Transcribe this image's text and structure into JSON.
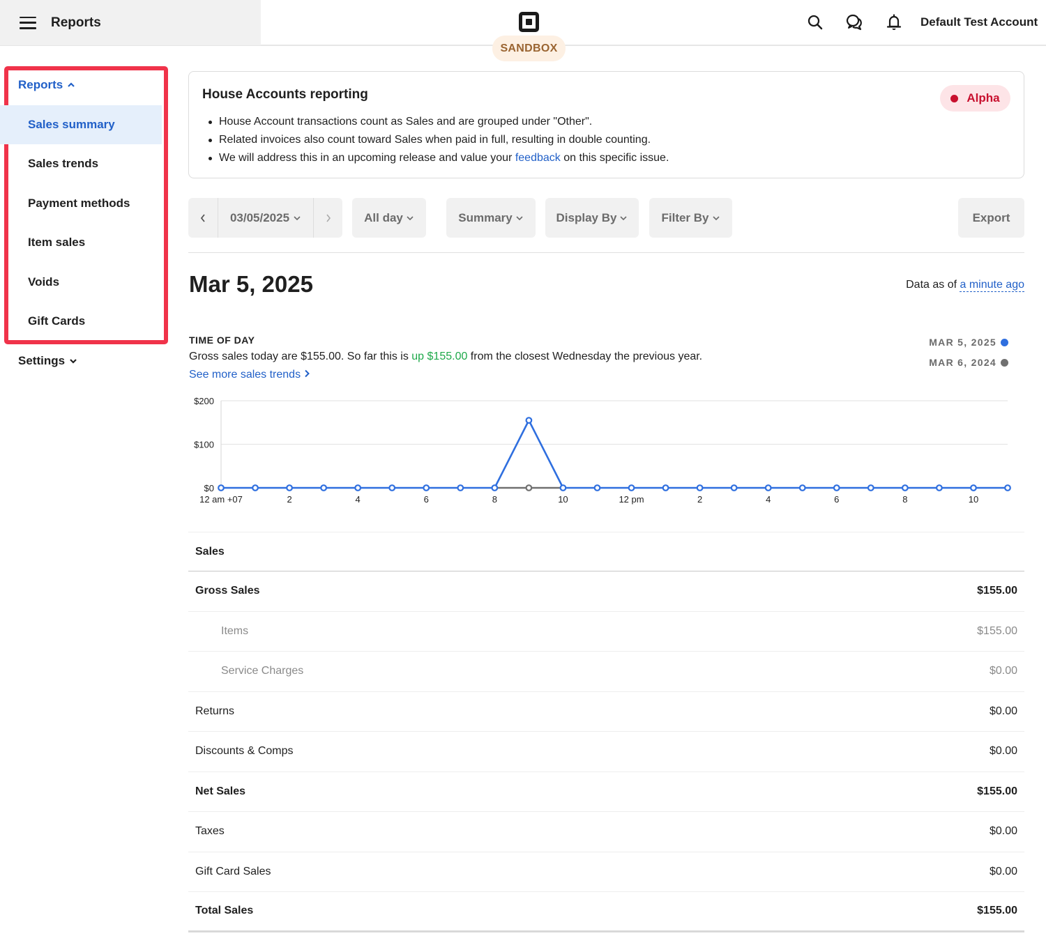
{
  "topbar": {
    "title": "Reports",
    "sandbox_label": "SANDBOX",
    "account_name": "Default Test Account",
    "icons": [
      "menu-icon",
      "square-logo-icon",
      "search-icon",
      "messages-icon",
      "bell-icon"
    ]
  },
  "sidebar": {
    "reports_label": "Reports",
    "settings_label": "Settings",
    "items": [
      {
        "label": "Sales summary",
        "active": true
      },
      {
        "label": "Sales trends",
        "active": false
      },
      {
        "label": "Payment methods",
        "active": false
      },
      {
        "label": "Item sales",
        "active": false
      },
      {
        "label": "Voids",
        "active": false
      },
      {
        "label": "Gift Cards",
        "active": false
      }
    ]
  },
  "banner": {
    "title": "House Accounts reporting",
    "badge": "Alpha",
    "bullets": [
      "House Account transactions count as Sales and are grouped under \"Other\".",
      "Related invoices also count toward Sales when paid in full, resulting in double counting."
    ],
    "bullet3_prefix": "We will address this in an upcoming release and value your ",
    "bullet3_link": "feedback",
    "bullet3_suffix": " on this specific issue."
  },
  "filters": {
    "date": "03/05/2025",
    "time_range": "All day",
    "report_type": "Summary",
    "display_by": "Display By",
    "filter_by": "Filter By",
    "export": "Export"
  },
  "report": {
    "date_heading": "Mar 5, 2025",
    "data_as_of_prefix": "Data as of ",
    "data_as_of_link": "a minute ago",
    "time_of_day_label": "TIME OF DAY",
    "summary_prefix": "Gross sales today are $155.00. So far this is ",
    "summary_highlight": "up $155.00",
    "summary_suffix": " from the closest Wednesday the previous year.",
    "trends_link": "See more sales trends"
  },
  "colors": {
    "accent": "#2160c8",
    "series_current": "#2f6fdf",
    "series_previous": "#707070",
    "positive": "#1ea94a",
    "alpha": "#c8102e",
    "highlight_frame": "#f0334a"
  },
  "chart_data": {
    "type": "line",
    "title": "TIME OF DAY",
    "xlabel": "",
    "ylabel": "",
    "ylim": [
      0,
      200
    ],
    "yticks": [
      "$0",
      "$100",
      "$200"
    ],
    "ytick_values": [
      0,
      100,
      200
    ],
    "x": [
      0,
      1,
      2,
      3,
      4,
      5,
      6,
      7,
      8,
      9,
      10,
      11,
      12,
      13,
      14,
      15,
      16,
      17,
      18,
      19,
      20,
      21,
      22,
      23
    ],
    "xtick_positions": [
      0,
      2,
      4,
      6,
      8,
      10,
      12,
      14,
      16,
      18,
      20,
      22
    ],
    "xtick_labels": [
      "12 am +07",
      "2",
      "4",
      "6",
      "8",
      "10",
      "12 pm",
      "2",
      "4",
      "6",
      "8",
      "10"
    ],
    "grid": true,
    "legend_position": "top-right",
    "series": [
      {
        "name": "MAR 5, 2025",
        "values": [
          0,
          0,
          0,
          0,
          0,
          0,
          0,
          0,
          0,
          155,
          0,
          0,
          0,
          0,
          0,
          0,
          0,
          0,
          0,
          0,
          0,
          0,
          0,
          0
        ]
      },
      {
        "name": "MAR 6, 2024",
        "values": [
          null,
          null,
          null,
          null,
          null,
          null,
          null,
          null,
          0,
          0,
          0,
          null,
          null,
          null,
          null,
          null,
          null,
          null,
          null,
          null,
          null,
          null,
          null,
          null
        ]
      }
    ]
  },
  "table": {
    "header": "Sales",
    "rows": [
      {
        "label": "Gross Sales",
        "value": "$155.00",
        "style": "bold"
      },
      {
        "label": "Items",
        "value": "$155.00",
        "style": "sub"
      },
      {
        "label": "Service Charges",
        "value": "$0.00",
        "style": "sub"
      },
      {
        "label": "Returns",
        "value": "$0.00",
        "style": ""
      },
      {
        "label": "Discounts & Comps",
        "value": "$0.00",
        "style": ""
      },
      {
        "label": "Net Sales",
        "value": "$155.00",
        "style": "bold"
      },
      {
        "label": "Taxes",
        "value": "$0.00",
        "style": ""
      },
      {
        "label": "Gift Card Sales",
        "value": "$0.00",
        "style": ""
      },
      {
        "label": "Total Sales",
        "value": "$155.00",
        "style": "bold last"
      }
    ]
  }
}
